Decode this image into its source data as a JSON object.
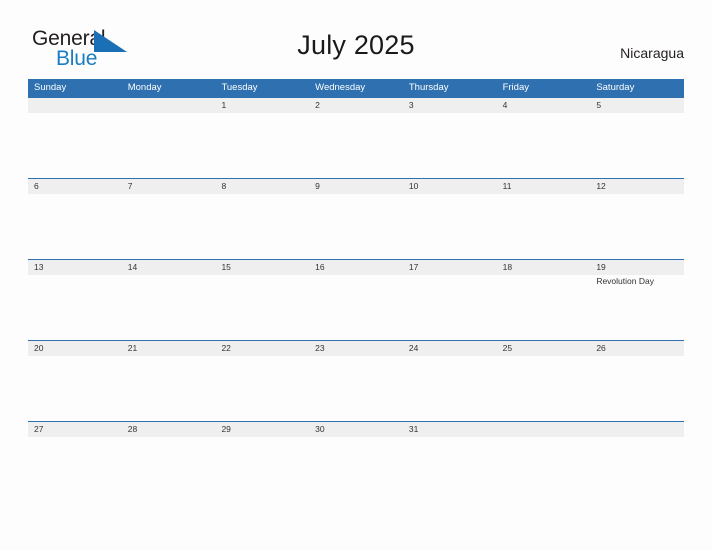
{
  "brand": {
    "name_part1": "General",
    "name_part2": "Blue",
    "triangle_color": "#1a6fb5",
    "blue_color": "#1a7dc4",
    "dark_color": "#231f20"
  },
  "header": {
    "title": "July 2025",
    "country": "Nicaragua"
  },
  "theme": {
    "header_blue": "#2e70b0",
    "date_band_gray": "#efefef",
    "page_background": "#fdfdfd",
    "text_dark": "#333333"
  },
  "weekdays": [
    "Sunday",
    "Monday",
    "Tuesday",
    "Wednesday",
    "Thursday",
    "Friday",
    "Saturday"
  ],
  "weeks": [
    {
      "days": [
        {
          "number": "",
          "event": ""
        },
        {
          "number": "",
          "event": ""
        },
        {
          "number": "1",
          "event": ""
        },
        {
          "number": "2",
          "event": ""
        },
        {
          "number": "3",
          "event": ""
        },
        {
          "number": "4",
          "event": ""
        },
        {
          "number": "5",
          "event": ""
        }
      ]
    },
    {
      "days": [
        {
          "number": "6",
          "event": ""
        },
        {
          "number": "7",
          "event": ""
        },
        {
          "number": "8",
          "event": ""
        },
        {
          "number": "9",
          "event": ""
        },
        {
          "number": "10",
          "event": ""
        },
        {
          "number": "11",
          "event": ""
        },
        {
          "number": "12",
          "event": ""
        }
      ]
    },
    {
      "days": [
        {
          "number": "13",
          "event": ""
        },
        {
          "number": "14",
          "event": ""
        },
        {
          "number": "15",
          "event": ""
        },
        {
          "number": "16",
          "event": ""
        },
        {
          "number": "17",
          "event": ""
        },
        {
          "number": "18",
          "event": ""
        },
        {
          "number": "19",
          "event": "Revolution Day"
        }
      ]
    },
    {
      "days": [
        {
          "number": "20",
          "event": ""
        },
        {
          "number": "21",
          "event": ""
        },
        {
          "number": "22",
          "event": ""
        },
        {
          "number": "23",
          "event": ""
        },
        {
          "number": "24",
          "event": ""
        },
        {
          "number": "25",
          "event": ""
        },
        {
          "number": "26",
          "event": ""
        }
      ]
    },
    {
      "days": [
        {
          "number": "27",
          "event": ""
        },
        {
          "number": "28",
          "event": ""
        },
        {
          "number": "29",
          "event": ""
        },
        {
          "number": "30",
          "event": ""
        },
        {
          "number": "31",
          "event": ""
        },
        {
          "number": "",
          "event": ""
        },
        {
          "number": "",
          "event": ""
        }
      ]
    }
  ]
}
